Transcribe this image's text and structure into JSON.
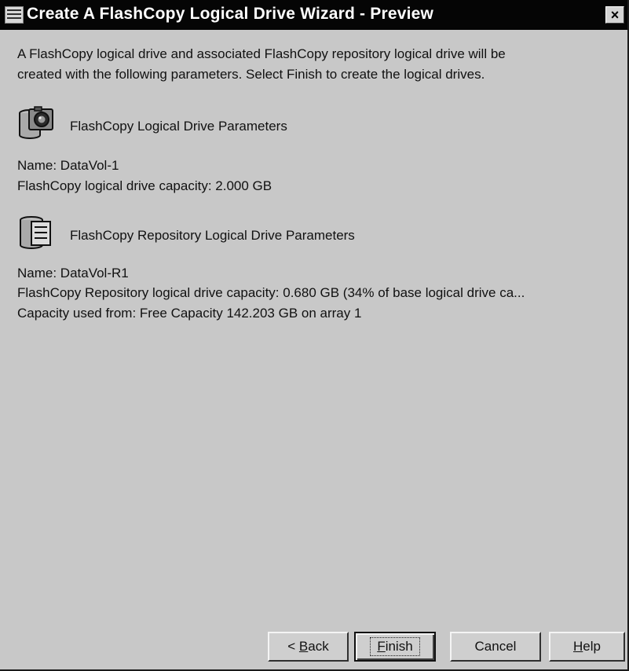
{
  "window": {
    "title": "Create A FlashCopy Logical Drive Wizard - Preview",
    "close_symbol": "×"
  },
  "intro": {
    "line1": "A FlashCopy logical drive and associated FlashCopy repository logical drive will be",
    "line2": "created with the following parameters. Select Finish to create the logical drives."
  },
  "flashcopy_section": {
    "icon": "flashcopy-drive-icon",
    "heading": "FlashCopy Logical Drive Parameters",
    "name": "Name: DataVol-1",
    "capacity": "FlashCopy logical drive capacity: 2.000 GB"
  },
  "repository_section": {
    "icon": "repository-drive-icon",
    "heading": "FlashCopy Repository Logical Drive Parameters",
    "name": "Name: DataVol-R1",
    "capacity": "FlashCopy Repository logical drive capacity: 0.680 GB (34% of base logical drive ca...",
    "capacity_used": "Capacity used from: Free Capacity 142.203 GB on array 1"
  },
  "buttons": {
    "back_prefix": "< ",
    "back_mnemonic": "B",
    "back_rest": "ack",
    "finish_mnemonic": "F",
    "finish_rest": "inish",
    "cancel": "Cancel",
    "help_mnemonic": "H",
    "help_rest": "elp"
  }
}
